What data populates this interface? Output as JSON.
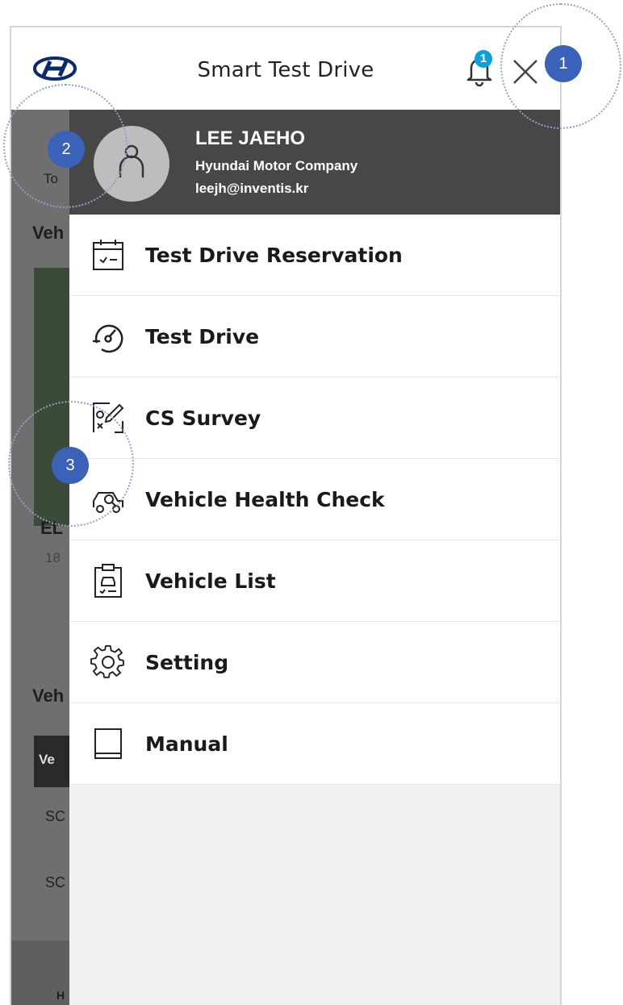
{
  "header": {
    "title": "Smart Test Drive",
    "notification_count": "1"
  },
  "profile": {
    "name": "LEE JAEHO",
    "company": "Hyundai Motor Company",
    "email": "leejh@inventis.kr"
  },
  "menu": {
    "items": [
      {
        "label": "Test Drive Reservation",
        "icon": "calendar-icon"
      },
      {
        "label": "Test Drive",
        "icon": "speedometer-icon"
      },
      {
        "label": "CS Survey",
        "icon": "survey-icon"
      },
      {
        "label": "Vehicle Health Check",
        "icon": "car-check-icon"
      },
      {
        "label": "Vehicle List",
        "icon": "clipboard-car-icon"
      },
      {
        "label": "Setting",
        "icon": "gear-icon"
      },
      {
        "label": "Manual",
        "icon": "book-icon"
      }
    ]
  },
  "background": {
    "to_text": "To",
    "veh1": "Veh",
    "el": "EL",
    "num": "18",
    "veh2": "Veh",
    "ve": "Ve",
    "sc1": "SC",
    "sc2": "SC",
    "h": "H"
  },
  "annotations": {
    "m1": "1",
    "m2": "2",
    "m3": "3"
  },
  "colors": {
    "drawer_header": "#474747",
    "badge": "#0aa0d8",
    "annotation_marker": "#3a62b8"
  }
}
